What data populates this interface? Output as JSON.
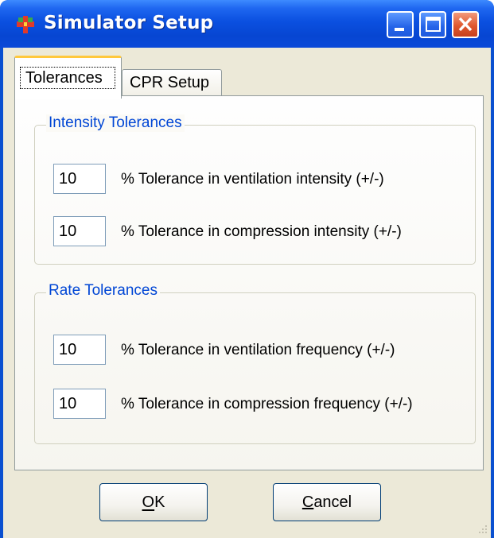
{
  "window": {
    "title": "Simulator Setup"
  },
  "tabs": [
    {
      "label": "Tolerances",
      "active": true
    },
    {
      "label": "CPR Setup",
      "active": false
    }
  ],
  "intensity_group": {
    "legend": "Intensity Tolerances",
    "rows": [
      {
        "value": "10",
        "label": "% Tolerance in ventilation intensity (+/-)"
      },
      {
        "value": "10",
        "label": "% Tolerance in compression intensity (+/-)"
      }
    ]
  },
  "rate_group": {
    "legend": "Rate Tolerances",
    "rows": [
      {
        "value": "10",
        "label": "% Tolerance in ventilation frequency (+/-)"
      },
      {
        "value": "10",
        "label": "% Tolerance in compression frequency (+/-)"
      }
    ]
  },
  "buttons": {
    "ok": "OK",
    "cancel": "Cancel"
  },
  "colors": {
    "titlebar": "#0b50e0",
    "legend_text": "#0046d5",
    "active_tab_highlight": "#ffc83c"
  },
  "icons": {
    "app": "plus-cross-icon",
    "minimize": "minimize-icon",
    "maximize": "maximize-icon",
    "close": "close-icon",
    "grip": "resize-grip-icon"
  }
}
